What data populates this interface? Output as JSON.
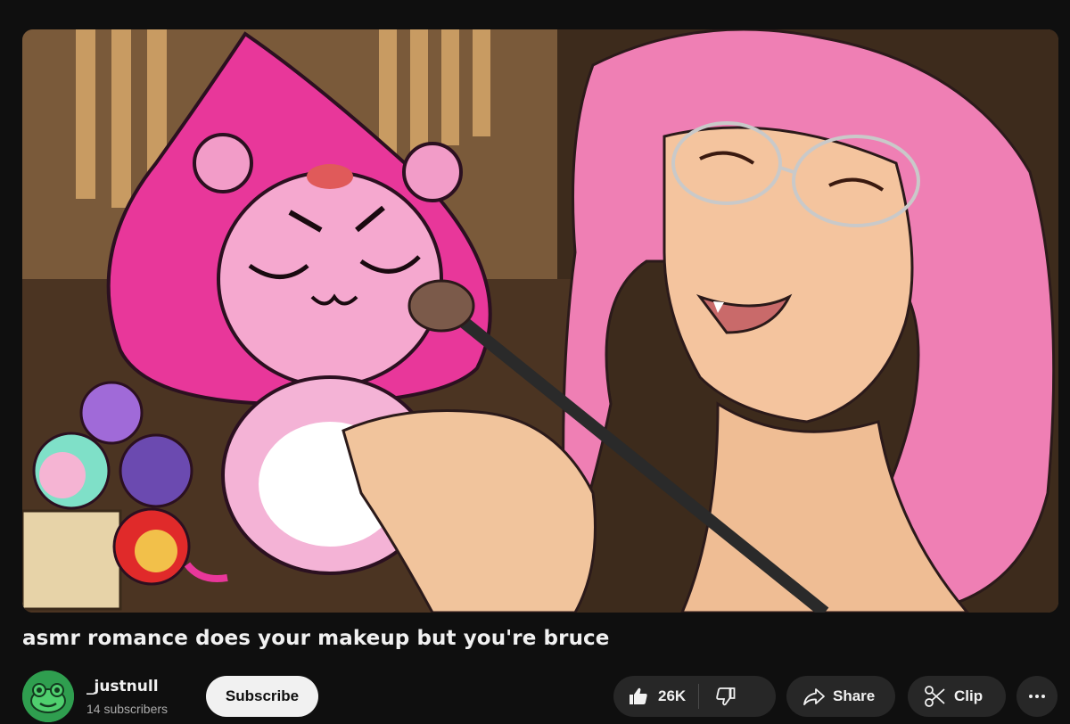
{
  "video": {
    "title": "asmr romance does your makeup but you're bruce",
    "thumbnail_icon": "anime-illustration-thumbnail"
  },
  "channel": {
    "name": "_justnull",
    "subscribers": "14 subscribers",
    "avatar_icon": "frog-avatar-icon"
  },
  "actions": {
    "subscribe_label": "Subscribe",
    "like_count": "26K",
    "share_label": "Share",
    "clip_label": "Clip"
  },
  "colors": {
    "background": "#0f0f0f",
    "pill": "#272727",
    "subscribe_bg": "#f1f1f1",
    "text_secondary": "#aaaaaa",
    "accent_pink": "#ee5fa9"
  }
}
